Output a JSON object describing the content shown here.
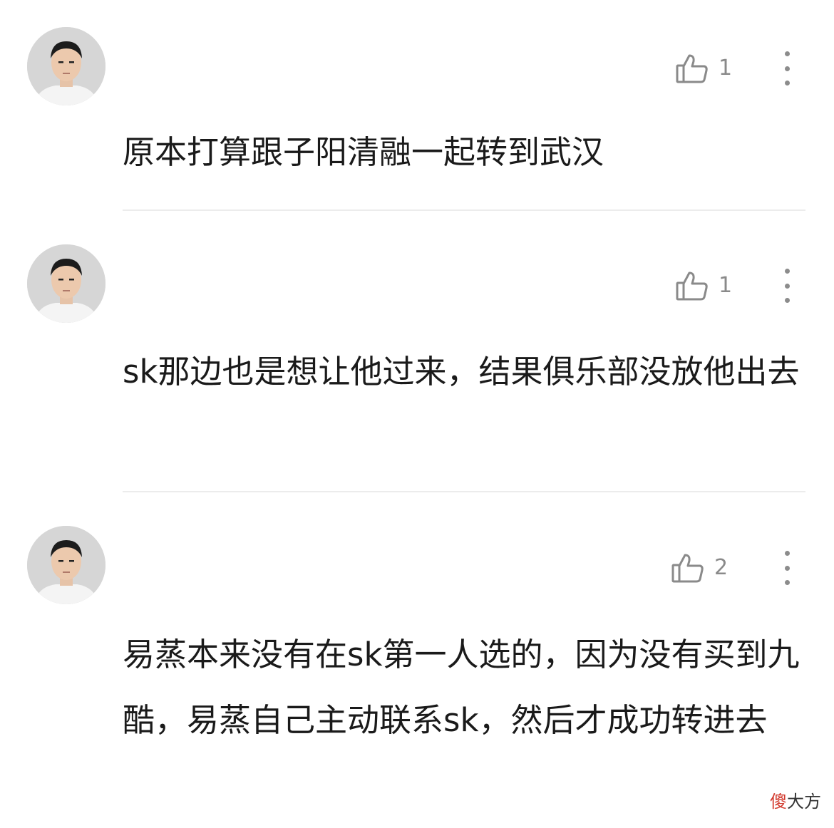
{
  "comments": [
    {
      "avatar_icon": "user-avatar-icon",
      "like_icon": "thumbs-up-icon",
      "like_count": "1",
      "more_icon": "more-vertical-icon",
      "text": "原本打算跟子阳清融一起转到武汉"
    },
    {
      "avatar_icon": "user-avatar-icon",
      "like_icon": "thumbs-up-icon",
      "like_count": "1",
      "more_icon": "more-vertical-icon",
      "text": "sk那边也是想让他过来，结果俱乐部没放他出去"
    },
    {
      "avatar_icon": "user-avatar-icon",
      "like_icon": "thumbs-up-icon",
      "like_count": "2",
      "more_icon": "more-vertical-icon",
      "text": "易蒸本来没有在sk第一人选的，因为没有买到九酷，易蒸自己主动联系sk，然后才成功转进去"
    }
  ],
  "watermark": {
    "char1": "傻",
    "char2": "大方",
    "char1_color": "#d23a2e"
  }
}
